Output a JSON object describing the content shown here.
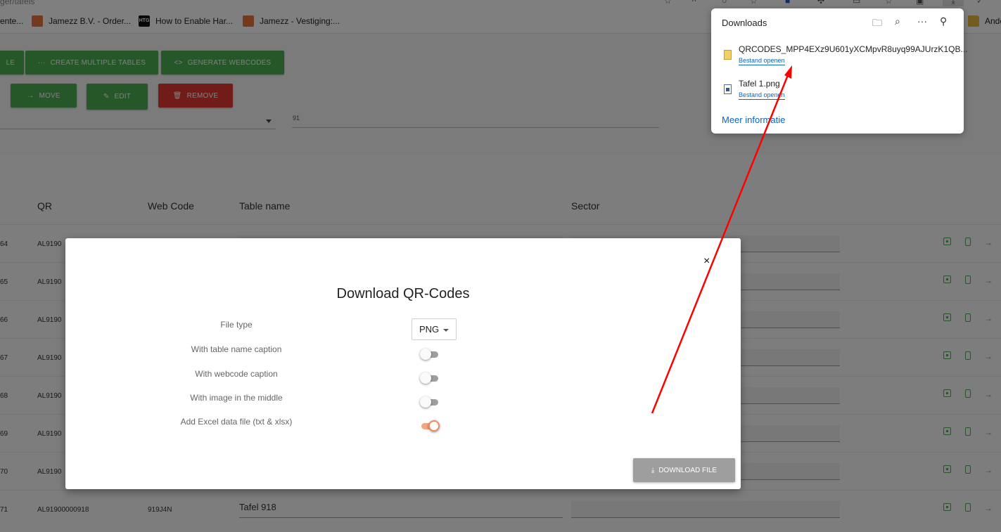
{
  "browser": {
    "url_fragment": "ger/tafels",
    "icons": [
      "reading-icon",
      "read-aloud-icon",
      "search-icon",
      "favorite-star-icon",
      "extension-icon",
      "puzzle-icon",
      "split-screen-icon",
      "favorites-icon",
      "collections-icon",
      "downloads-icon",
      "profile-icon"
    ],
    "bookmarks": [
      {
        "label": "ente...",
        "icon": "none"
      },
      {
        "label": "Jamezz B.V. - Order...",
        "icon": "jamezz"
      },
      {
        "label": "How to Enable Har...",
        "icon": "htg",
        "icon_text": "HTG"
      },
      {
        "label": "Jamezz - Vestiging:...",
        "icon": "jamezz"
      },
      {
        "label": "Ande",
        "icon": "folder"
      }
    ]
  },
  "toolbar": {
    "create_single_partial": "LE",
    "create_multiple": "CREATE MULTIPLE TABLES",
    "generate_webcodes": "GENERATE WEBCODES",
    "move": "MOVE",
    "edit": "EDIT",
    "remove": "REMOVE",
    "select_value": "",
    "field_value": "91"
  },
  "colors": {
    "green": "#4caf50",
    "red": "#e53935",
    "toggle_on": "#f08a5d",
    "link_blue": "#0a65c2",
    "annotation_arrow": "#ff0000"
  },
  "table": {
    "headers": {
      "qr": "QR",
      "webcode": "Web Code",
      "table_name": "Table name",
      "sector": "Sector"
    },
    "rows": [
      {
        "num": "64",
        "qr": "AL9190",
        "webcode": "",
        "name": ""
      },
      {
        "num": "65",
        "qr": "AL9190",
        "webcode": "",
        "name": ""
      },
      {
        "num": "66",
        "qr": "AL9190",
        "webcode": "",
        "name": ""
      },
      {
        "num": "67",
        "qr": "AL9190",
        "webcode": "",
        "name": ""
      },
      {
        "num": "68",
        "qr": "AL9190",
        "webcode": "",
        "name": ""
      },
      {
        "num": "69",
        "qr": "AL9190",
        "webcode": "",
        "name": ""
      },
      {
        "num": "70",
        "qr": "AL9190",
        "webcode": "",
        "name": ""
      },
      {
        "num": "71",
        "qr": "AL91900000918",
        "webcode": "919J4N",
        "name": "Tafel 918"
      }
    ],
    "row_action_icons": [
      "scan-qr-icon",
      "phone-icon",
      "arrow-right-icon"
    ]
  },
  "modal": {
    "title": "Download QR-Codes",
    "close": "×",
    "options": [
      {
        "label": "File type",
        "type": "select",
        "value": "PNG"
      },
      {
        "label": "With table name caption",
        "type": "toggle",
        "on": false
      },
      {
        "label": "With webcode caption",
        "type": "toggle",
        "on": false
      },
      {
        "label": "With image in the middle",
        "type": "toggle",
        "on": false
      },
      {
        "label": "Add Excel data file (txt & xlsx)",
        "type": "toggle",
        "on": true
      }
    ],
    "download_button": "DOWNLOAD FILE"
  },
  "downloads": {
    "title": "Downloads",
    "tool_icons": [
      "open-folder-icon",
      "search-icon",
      "more-icon",
      "pin-icon"
    ],
    "items": [
      {
        "name": "QRCODES_MPP4EXz9U601yXCMpvR8uyq99AJUrzK1QB...",
        "action": "Bestand openen",
        "icon": "zip-file-icon"
      },
      {
        "name": "Tafel 1.png",
        "action": "Bestand openen",
        "icon": "png-file-icon"
      }
    ],
    "more_info": "Meer informatie"
  }
}
